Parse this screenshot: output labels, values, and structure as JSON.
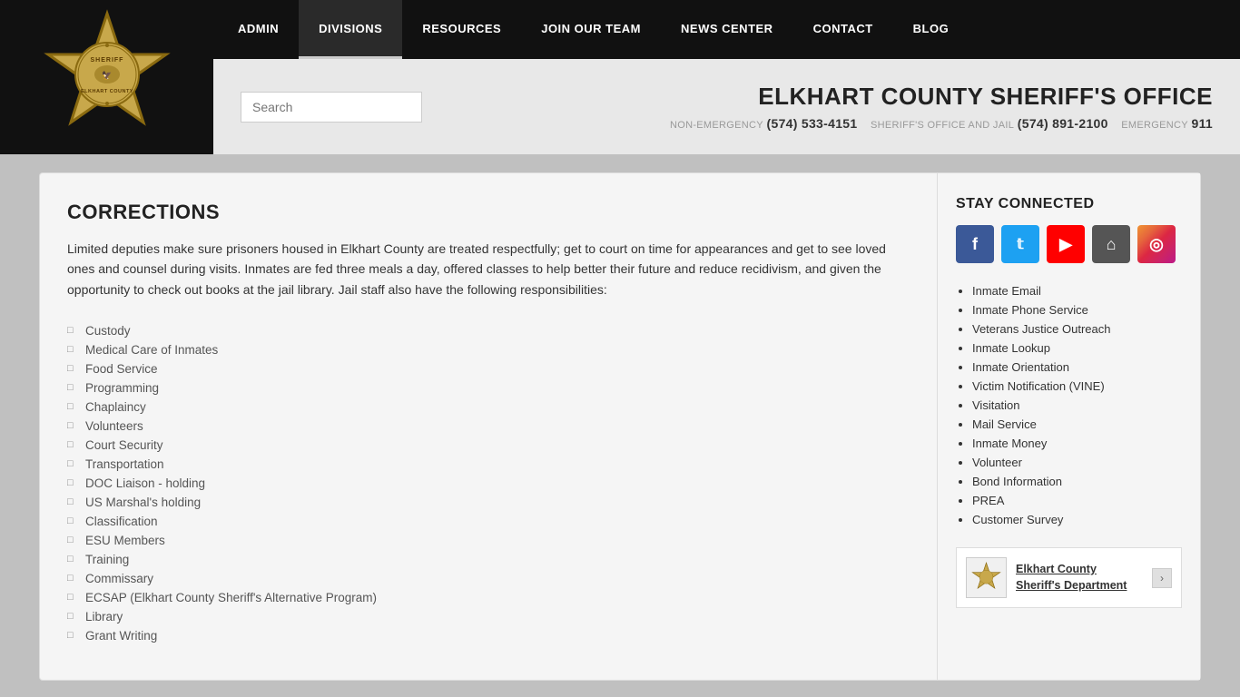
{
  "header": {
    "nav_items": [
      {
        "label": "ADMIN",
        "active": false
      },
      {
        "label": "DIVISIONS",
        "active": true
      },
      {
        "label": "RESOURCES",
        "active": false
      },
      {
        "label": "JOIN OUR TEAM",
        "active": false
      },
      {
        "label": "NEWS CENTER",
        "active": false
      },
      {
        "label": "CONTACT",
        "active": false
      },
      {
        "label": "BLOG",
        "active": false
      }
    ]
  },
  "subheader": {
    "search_placeholder": "Search",
    "office_title": "ELKHART COUNTY SHERIFF'S OFFICE",
    "phone_non_emergency_label": "NON-EMERGENCY",
    "phone_non_emergency": "(574) 533-4151",
    "phone_jail_label": "SHERIFF'S OFFICE AND JAIL",
    "phone_jail": "(574) 891-2100",
    "phone_emergency_label": "EMERGENCY",
    "phone_emergency": "911"
  },
  "main": {
    "section_title": "CORRECTIONS",
    "section_desc": "Limited deputies make sure prisoners housed in Elkhart County are treated respectfully; get to court on time for appearances and get to see loved ones and counsel during visits. Inmates are fed three meals a day, offered classes to help better their future and reduce recidivism, and given the opportunity to check out books at the jail library. Jail staff also have the following responsibilities:",
    "list_items": [
      "Custody",
      "Medical Care of Inmates",
      "Food Service",
      "Programming",
      "Chaplaincy",
      "Volunteers",
      "Court Security",
      "Transportation",
      "DOC Liaison - holding",
      "US Marshal's holding",
      "Classification",
      "ESU Members",
      "Training",
      "Commissary",
      "ECSAP (Elkhart County Sheriff's Alternative Program)",
      "Library",
      "Grant Writing"
    ]
  },
  "sidebar": {
    "stay_connected_title": "STAY CONNECTED",
    "social_icons": [
      {
        "name": "facebook",
        "label": "f",
        "class": "si-fb"
      },
      {
        "name": "twitter",
        "label": "t",
        "class": "si-tw"
      },
      {
        "name": "youtube",
        "label": "▶",
        "class": "si-yt"
      },
      {
        "name": "home",
        "label": "⌂",
        "class": "si-home"
      },
      {
        "name": "instagram",
        "label": "◎",
        "class": "si-ig"
      }
    ],
    "links": [
      "Inmate Email",
      "Inmate Phone Service",
      "Veterans Justice Outreach",
      "Inmate Lookup",
      "Inmate Orientation",
      "Victim Notification (VINE)",
      "Visitation",
      "Mail Service",
      "Inmate Money",
      "Volunteer",
      "Bond Information",
      "PREA",
      "Customer Survey"
    ],
    "widget_text_line1": "Elkhart County",
    "widget_text_line2": "Sheriff's Department"
  }
}
